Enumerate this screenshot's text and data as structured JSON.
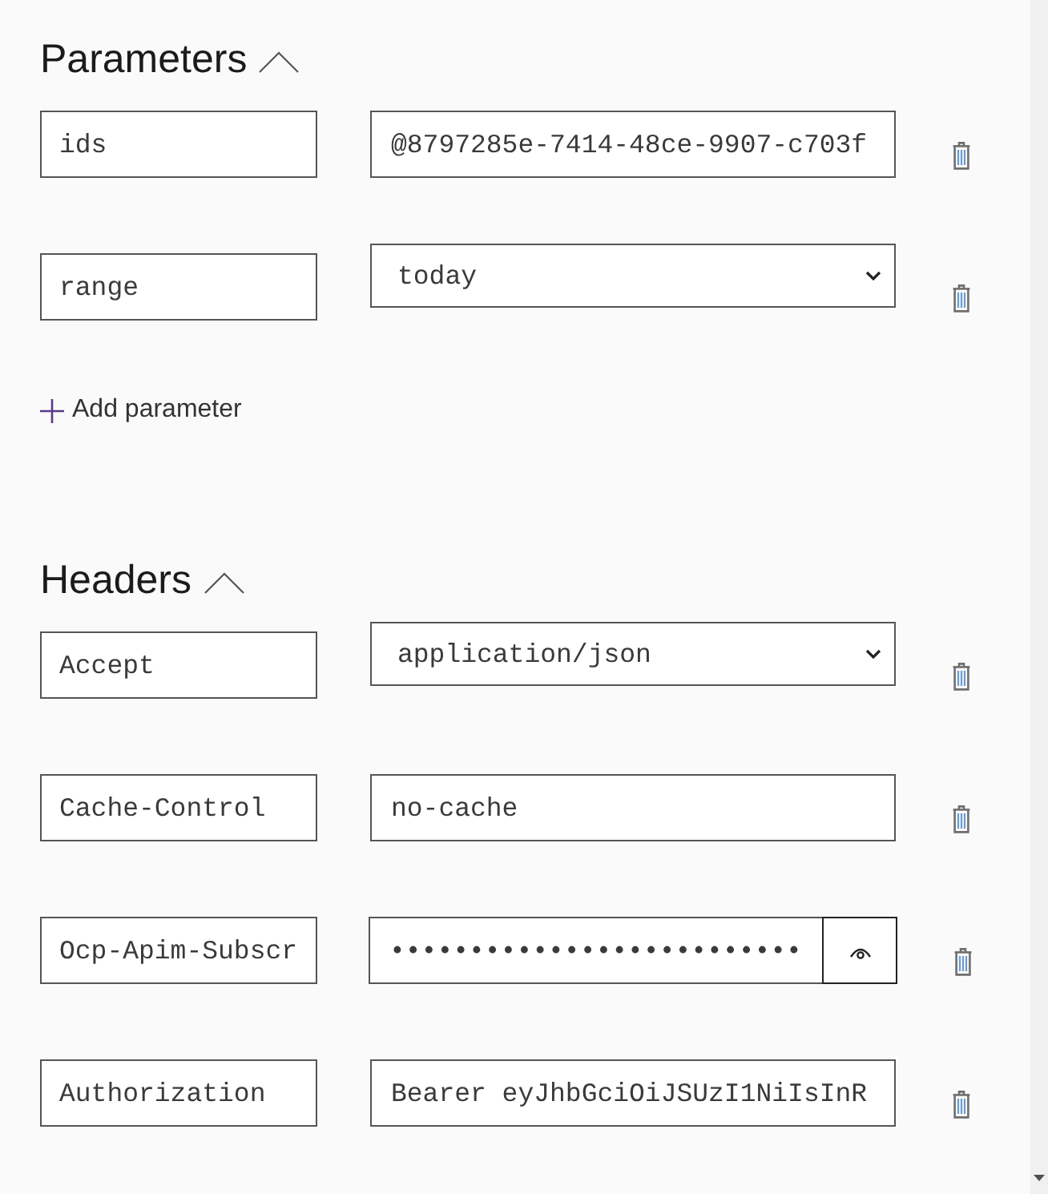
{
  "parameters": {
    "title": "Parameters",
    "expanded": true,
    "rows": [
      {
        "name": "ids",
        "kind": "text",
        "value": "@8797285e-7414-48ce-9907-c703f"
      },
      {
        "name": "range",
        "kind": "select",
        "value": "today"
      }
    ],
    "add_label": "Add parameter"
  },
  "headers": {
    "title": "Headers",
    "expanded": true,
    "rows": [
      {
        "name": "Accept",
        "kind": "select",
        "value": "application/json"
      },
      {
        "name": "Cache-Control",
        "kind": "text",
        "value": "no-cache"
      },
      {
        "name": "Ocp-Apim-Subscr",
        "kind": "password",
        "value": "••••••••••••••••••••••••••"
      },
      {
        "name": "Authorization",
        "kind": "text",
        "value": "Bearer eyJhbGciOiJSUzI1NiIsInR"
      }
    ]
  }
}
